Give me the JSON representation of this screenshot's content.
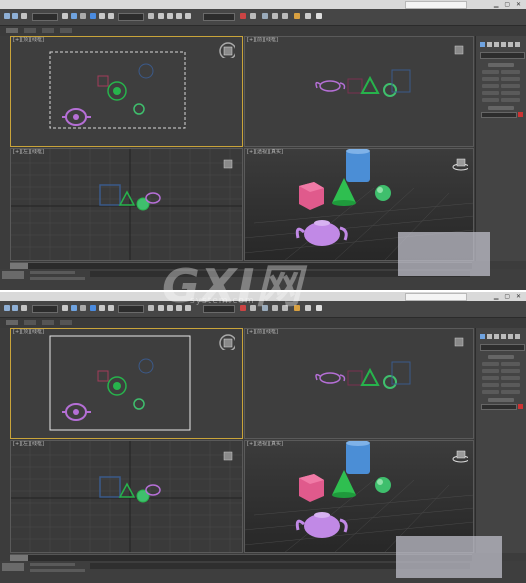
{
  "watermark": {
    "logo_text": "GXI网",
    "sub_text": "system.com"
  },
  "colors": {
    "viewport_bg": "#3c3c3c",
    "active_border": "#c9a43a",
    "teapot": "#b56fd6",
    "sphere": "#3fbf6d",
    "cone": "#27b34c",
    "cylinder": "#4b8ed6",
    "box": "#e05a8c"
  },
  "screens": [
    {
      "id": "before",
      "selection_rect_style": "dashed",
      "timeline": {
        "position": "0 / 100"
      },
      "viewports": [
        "top",
        "front",
        "left",
        "perspective"
      ]
    },
    {
      "id": "after",
      "selection_rect_style": "solid",
      "timeline": {
        "position": "0 / 100"
      },
      "viewports": [
        "top",
        "front",
        "left",
        "perspective"
      ]
    }
  ]
}
